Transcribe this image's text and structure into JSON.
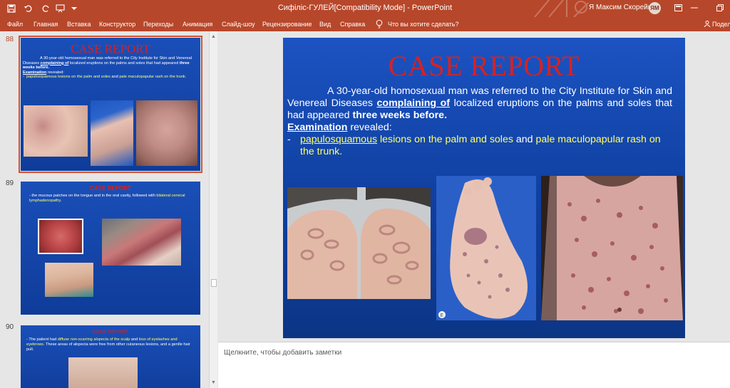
{
  "titlebar": {
    "doc_title": "Сифіліс-ГУЛЕЙ[Compatibility Mode]  -  PowerPoint",
    "user_name": "Я Максим Скорейко",
    "user_initials": "ЯМ",
    "quick_access": [
      "save-icon",
      "undo-icon",
      "redo-icon",
      "start-slideshow-icon",
      "customize-icon"
    ],
    "window_controls": [
      "ribbon-display-options-icon",
      "minimize-icon",
      "restore-icon"
    ]
  },
  "ribbon": {
    "tabs": [
      "Файл",
      "Главная",
      "Вставка",
      "Конструктор",
      "Переходы",
      "Анимация",
      "Слайд-шоу",
      "Рецензирование",
      "Вид",
      "Справка"
    ],
    "tell_me": "Что вы хотите сделать?",
    "share": "Подел"
  },
  "thumbnails": [
    {
      "number": "88",
      "title": "CASE REPORT",
      "text_lead": "A 30-year-old homosexual man was referred to the City Institute for Skin and Venereal Diseases",
      "text_complaint": "complaining of",
      "text_rest": "localized eruptions on the palms and soles that had appeared",
      "text_bold": "three weeks before.",
      "exam_label": "Examination",
      "exam_rest": "revealed:",
      "bullet_yellow": "papulosquamous lesions on the palm and soles",
      "bullet_and": "and",
      "bullet_yellow2": "pale maculopapular rash on the trunk."
    },
    {
      "number": "89",
      "title": "CASE REPORT",
      "text": "- the mucous patches on the tongue and in the oral cavity, followed with",
      "text_yellow": "bilateral cervical lymphadenopathy."
    },
    {
      "number": "90",
      "title": "CASE REPORT",
      "text_lead": "- The patient had",
      "text_yellow": "diffuse non-scarring alopecia of the scalp",
      "text_and": "and",
      "text_yellow2": "loss of eyelashes and eyebrows.",
      "text_rest": "These areas of alopecia were free from other cutaneous lesions, and a gentle hair pull."
    }
  ],
  "slide": {
    "title": "CASE REPORT",
    "para_lead": "A 30-year-old homosexual man was referred to the City Institute for Skin and Venereal Diseases",
    "complaint": "complaining of",
    "para_rest": "localized eruptions on the palms and soles that had appeared",
    "para_bold": "three weeks before.",
    "exam_label": "Examination",
    "exam_rest": "revealed:",
    "bullet_dash": "-",
    "bullet_u": "papulosquamous",
    "bullet_y1": "lesions on the palm and soles",
    "bullet_and": "and",
    "bullet_y2": "pale maculopapular rash on the trunk",
    "bullet_end": ".",
    "photo_logo": "E"
  },
  "notes": {
    "placeholder": "Щелкните, чтобы добавить заметки"
  },
  "colors": {
    "ribbon": "#b7472a",
    "slide_bg": "#1c53c2",
    "title_red": "#d62222",
    "highlight_yellow": "#ffff66"
  }
}
